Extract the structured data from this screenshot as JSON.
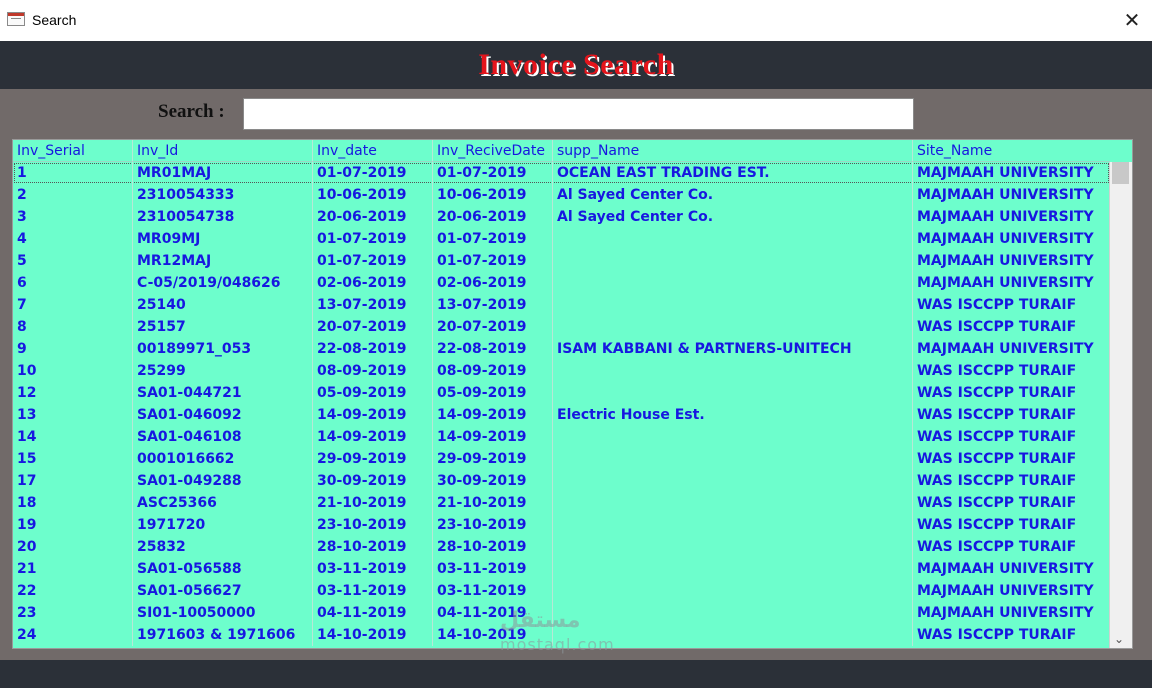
{
  "window": {
    "title": "Search",
    "close_glyph": "✕"
  },
  "header": {
    "title": "Invoice Search"
  },
  "search": {
    "label": "Search :",
    "value": "",
    "placeholder": ""
  },
  "grid": {
    "columns": [
      "Inv_Serial",
      "Inv_Id",
      "Inv_date",
      "Inv_ReciveDate",
      "supp_Name",
      "Site_Name"
    ],
    "rows": [
      [
        "1",
        "MR01MAJ",
        "01-07-2019",
        "01-07-2019",
        "OCEAN EAST TRADING EST.",
        "MAJMAAH UNIVERSITY"
      ],
      [
        "2",
        "2310054333",
        "10-06-2019",
        "10-06-2019",
        "Al Sayed Center Co.",
        "MAJMAAH UNIVERSITY"
      ],
      [
        "3",
        "2310054738",
        "20-06-2019",
        "20-06-2019",
        "Al Sayed Center Co.",
        "MAJMAAH UNIVERSITY"
      ],
      [
        "4",
        "MR09MJ",
        "01-07-2019",
        "01-07-2019",
        "",
        "MAJMAAH UNIVERSITY"
      ],
      [
        "5",
        "MR12MAJ",
        "01-07-2019",
        "01-07-2019",
        "",
        "MAJMAAH UNIVERSITY"
      ],
      [
        "6",
        "C-05/2019/048626",
        "02-06-2019",
        "02-06-2019",
        "",
        "MAJMAAH UNIVERSITY"
      ],
      [
        "7",
        "25140",
        "13-07-2019",
        "13-07-2019",
        "",
        "WAS ISCCPP TURAIF"
      ],
      [
        "8",
        "25157",
        "20-07-2019",
        "20-07-2019",
        "",
        "WAS ISCCPP TURAIF"
      ],
      [
        "9",
        "00189971_053",
        "22-08-2019",
        "22-08-2019",
        "ISAM KABBANI & PARTNERS-UNITECH",
        "MAJMAAH UNIVERSITY"
      ],
      [
        "10",
        "25299",
        "08-09-2019",
        "08-09-2019",
        "",
        "WAS ISCCPP TURAIF"
      ],
      [
        "12",
        "SA01-044721",
        "05-09-2019",
        "05-09-2019",
        "",
        "WAS ISCCPP TURAIF"
      ],
      [
        "13",
        "SA01-046092",
        "14-09-2019",
        "14-09-2019",
        "Electric House Est.",
        "WAS ISCCPP TURAIF"
      ],
      [
        "14",
        "SA01-046108",
        "14-09-2019",
        "14-09-2019",
        "",
        "WAS ISCCPP TURAIF"
      ],
      [
        "15",
        "0001016662",
        "29-09-2019",
        "29-09-2019",
        "",
        "WAS ISCCPP TURAIF"
      ],
      [
        "17",
        "SA01-049288",
        "30-09-2019",
        "30-09-2019",
        "",
        "WAS ISCCPP TURAIF"
      ],
      [
        "18",
        "ASC25366",
        "21-10-2019",
        "21-10-2019",
        "",
        "WAS ISCCPP TURAIF"
      ],
      [
        "19",
        "1971720",
        "23-10-2019",
        "23-10-2019",
        "",
        "WAS ISCCPP TURAIF"
      ],
      [
        "20",
        "25832",
        "28-10-2019",
        "28-10-2019",
        "",
        "WAS ISCCPP TURAIF"
      ],
      [
        "21",
        "SA01-056588",
        "03-11-2019",
        "03-11-2019",
        "",
        "MAJMAAH UNIVERSITY"
      ],
      [
        "22",
        "SA01-056627",
        "03-11-2019",
        "03-11-2019",
        "",
        "MAJMAAH UNIVERSITY"
      ],
      [
        "23",
        "SI01-10050000",
        "04-11-2019",
        "04-11-2019",
        "",
        "MAJMAAH UNIVERSITY"
      ],
      [
        "24",
        "1971603 & 1971606",
        "14-10-2019",
        "14-10-2019",
        "",
        "WAS ISCCPP TURAIF"
      ]
    ]
  },
  "scrollbar": {
    "down_glyph": "⌄"
  },
  "watermark": {
    "arabic": "مستقل",
    "latin": "mostaql.com"
  },
  "colors": {
    "grid_bg": "#6dfecc",
    "text": "#1717e0",
    "header_band": "#2b3038",
    "body_bg": "#716a69",
    "title_red": "#e4141b"
  }
}
